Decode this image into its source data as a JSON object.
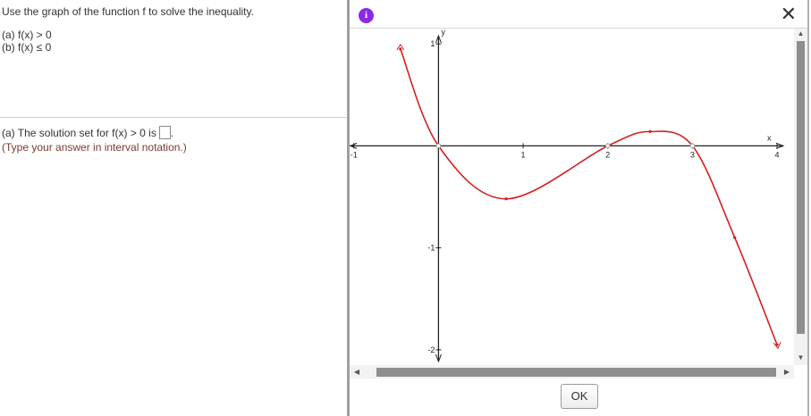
{
  "question": {
    "instruction": "Use the graph of the function f to solve the inequality.",
    "part_a": "(a) f(x) > 0",
    "part_b": "(b) f(x) ≤ 0",
    "answer_prefix": "(a) The solution set for f(x) > 0 is",
    "answer_suffix": ".",
    "hint": "(Type your answer in interval notation.)"
  },
  "dialog": {
    "info_icon": "i",
    "close_icon": "✕",
    "ok_label": "OK"
  },
  "chart_data": {
    "type": "line",
    "xlabel": "x",
    "ylabel": "y",
    "xlim": [
      -1.05,
      4.2
    ],
    "ylim": [
      -2.15,
      1.15
    ],
    "x_ticks": [
      -1,
      1,
      2,
      3,
      4
    ],
    "y_ticks": [
      1,
      -1,
      -2
    ],
    "grid": false,
    "series": [
      {
        "color": "#d42020",
        "x": [
          -0.45,
          0,
          0.8,
          2,
          2.5,
          3,
          3.5,
          4.0
        ],
        "y": [
          0.95,
          0,
          -0.52,
          0,
          0.14,
          0,
          -0.9,
          -1.95
        ]
      }
    ]
  }
}
